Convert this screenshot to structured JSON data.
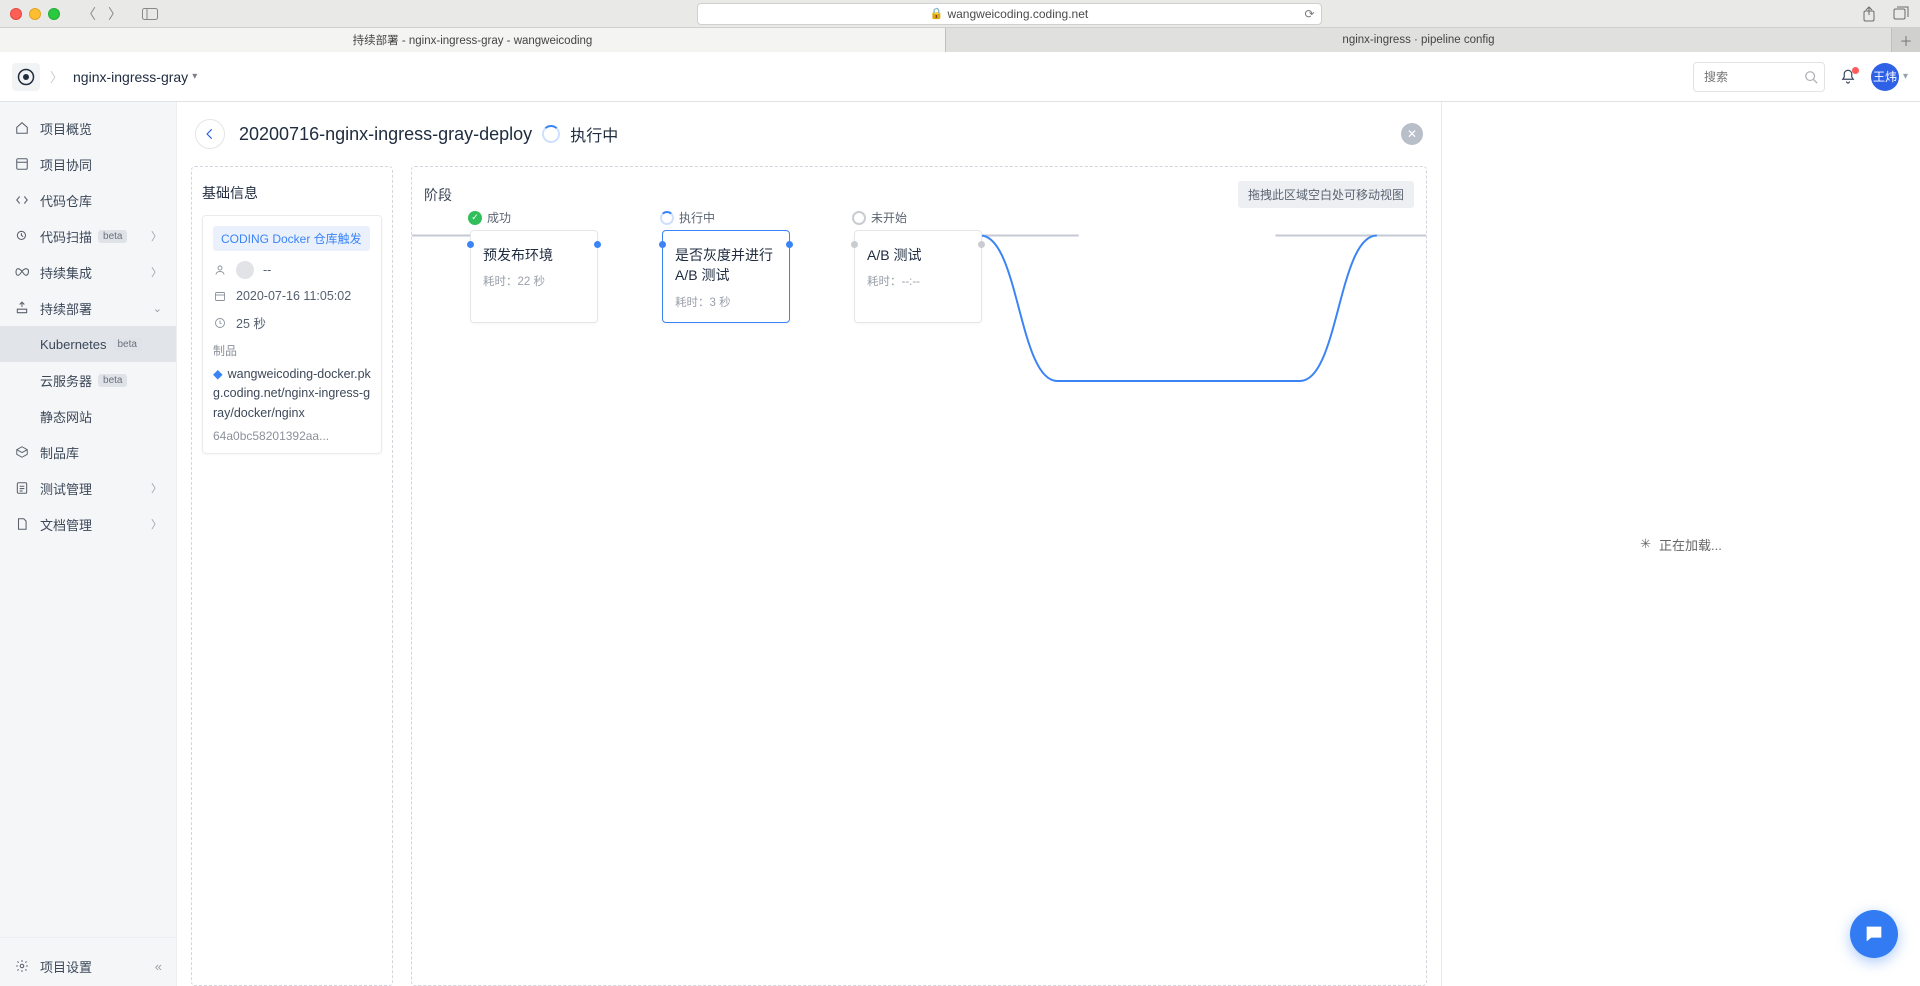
{
  "browser": {
    "url_host": "wangweicoding.coding.net",
    "tabs": [
      {
        "title": "持续部署 - nginx-ingress-gray - wangweicoding",
        "active": true
      },
      {
        "title": "nginx-ingress · pipeline config",
        "active": false
      }
    ]
  },
  "header": {
    "breadcrumb": "nginx-ingress-gray",
    "search_placeholder": "搜索",
    "avatar_text": "王炜"
  },
  "sidebar": {
    "items": [
      {
        "icon": "home-icon",
        "label": "项目概览"
      },
      {
        "icon": "board-icon",
        "label": "项目协同"
      },
      {
        "icon": "code-icon",
        "label": "代码仓库"
      },
      {
        "icon": "scan-icon",
        "label": "代码扫描",
        "beta": true,
        "expand": true
      },
      {
        "icon": "infinity-icon",
        "label": "持续集成",
        "expand": true
      },
      {
        "icon": "deploy-icon",
        "label": "持续部署",
        "expand": true,
        "expanded": true,
        "children": [
          {
            "label": "Kubernetes",
            "beta": true,
            "active": true
          },
          {
            "label": "云服务器",
            "beta": true
          },
          {
            "label": "静态网站"
          }
        ]
      },
      {
        "icon": "package-icon",
        "label": "制品库"
      },
      {
        "icon": "test-icon",
        "label": "测试管理",
        "expand": true
      },
      {
        "icon": "doc-icon",
        "label": "文档管理",
        "expand": true
      }
    ],
    "footer": {
      "icon": "gear-icon",
      "label": "项目设置"
    }
  },
  "page": {
    "title": "20200716-nginx-ingress-gray-deploy",
    "status": "执行中"
  },
  "info": {
    "title": "基础信息",
    "trigger": "CODING Docker 仓库触发",
    "user": "--",
    "time": "2020-07-16 11:05:02",
    "duration": "25 秒",
    "artifact_label": "制品",
    "artifact_name": "wangweicoding-docker.pkg.coding.net/nginx-ingress-gray/docker/nginx",
    "artifact_hash": "64a0bc58201392aa..."
  },
  "stages": {
    "title": "阶段",
    "drag_hint": "拖拽此区域空白处可移动视图",
    "duration_label": "耗时：",
    "list": [
      {
        "status": "success",
        "status_label": "成功",
        "name": "预发布环境",
        "duration": "22 秒"
      },
      {
        "status": "running",
        "status_label": "执行中",
        "name": "是否灰度并进行 A/B 测试",
        "duration": "3 秒"
      },
      {
        "status": "idle",
        "status_label": "未开始",
        "name": "A/B 测试",
        "duration": "--:--"
      }
    ]
  },
  "right_panel": {
    "loading_text": "正在加载..."
  }
}
